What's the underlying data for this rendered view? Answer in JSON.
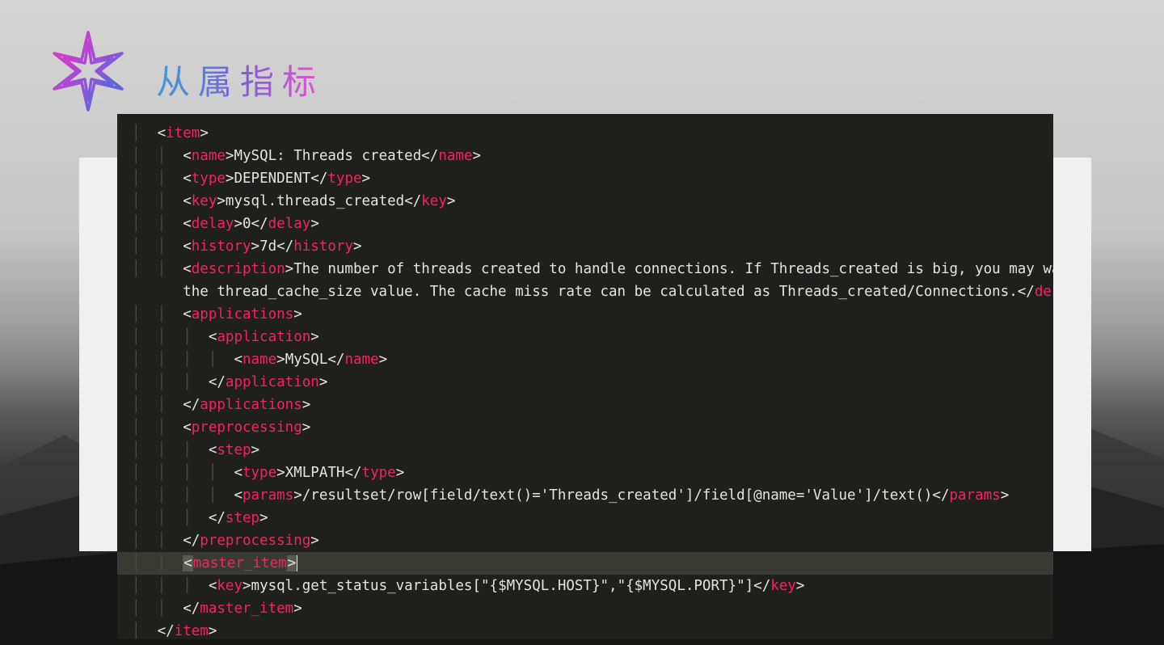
{
  "title": "从属指标",
  "code": {
    "lines": [
      {
        "indent": 1,
        "tokens": [
          {
            "t": "bracket",
            "v": "<"
          },
          {
            "t": "tag",
            "v": "item"
          },
          {
            "t": "bracket",
            "v": ">"
          }
        ]
      },
      {
        "indent": 2,
        "tokens": [
          {
            "t": "bracket",
            "v": "<"
          },
          {
            "t": "tag",
            "v": "name"
          },
          {
            "t": "bracket",
            "v": ">"
          },
          {
            "t": "text",
            "v": "MySQL: Threads created"
          },
          {
            "t": "bracket",
            "v": "</"
          },
          {
            "t": "tag",
            "v": "name"
          },
          {
            "t": "bracket",
            "v": ">"
          }
        ]
      },
      {
        "indent": 2,
        "tokens": [
          {
            "t": "bracket",
            "v": "<"
          },
          {
            "t": "tag",
            "v": "type"
          },
          {
            "t": "bracket",
            "v": ">"
          },
          {
            "t": "text",
            "v": "DEPENDENT"
          },
          {
            "t": "bracket",
            "v": "</"
          },
          {
            "t": "tag",
            "v": "type"
          },
          {
            "t": "bracket",
            "v": ">"
          }
        ]
      },
      {
        "indent": 2,
        "tokens": [
          {
            "t": "bracket",
            "v": "<"
          },
          {
            "t": "tag",
            "v": "key"
          },
          {
            "t": "bracket",
            "v": ">"
          },
          {
            "t": "text",
            "v": "mysql.threads_created"
          },
          {
            "t": "bracket",
            "v": "</"
          },
          {
            "t": "tag",
            "v": "key"
          },
          {
            "t": "bracket",
            "v": ">"
          }
        ]
      },
      {
        "indent": 2,
        "tokens": [
          {
            "t": "bracket",
            "v": "<"
          },
          {
            "t": "tag",
            "v": "delay"
          },
          {
            "t": "bracket",
            "v": ">"
          },
          {
            "t": "text",
            "v": "0"
          },
          {
            "t": "bracket",
            "v": "</"
          },
          {
            "t": "tag",
            "v": "delay"
          },
          {
            "t": "bracket",
            "v": ">"
          }
        ]
      },
      {
        "indent": 2,
        "tokens": [
          {
            "t": "bracket",
            "v": "<"
          },
          {
            "t": "tag",
            "v": "history"
          },
          {
            "t": "bracket",
            "v": ">"
          },
          {
            "t": "text",
            "v": "7d"
          },
          {
            "t": "bracket",
            "v": "</"
          },
          {
            "t": "tag",
            "v": "history"
          },
          {
            "t": "bracket",
            "v": ">"
          }
        ]
      },
      {
        "indent": 2,
        "tokens": [
          {
            "t": "bracket",
            "v": "<"
          },
          {
            "t": "tag",
            "v": "description"
          },
          {
            "t": "bracket",
            "v": ">"
          },
          {
            "t": "text",
            "v": "The number of threads created to handle connections. If Threads_created is big, you may want"
          }
        ]
      },
      {
        "indent": 2,
        "rawprefix": "",
        "tokens": [
          {
            "t": "text",
            "v": "the thread_cache_size value. The cache miss rate can be calculated as Threads_created/Connections."
          },
          {
            "t": "bracket",
            "v": "</"
          },
          {
            "t": "tag",
            "v": "descr"
          }
        ]
      },
      {
        "indent": 2,
        "tokens": [
          {
            "t": "bracket",
            "v": "<"
          },
          {
            "t": "tag",
            "v": "applications"
          },
          {
            "t": "bracket",
            "v": ">"
          }
        ]
      },
      {
        "indent": 3,
        "tokens": [
          {
            "t": "bracket",
            "v": "<"
          },
          {
            "t": "tag",
            "v": "application"
          },
          {
            "t": "bracket",
            "v": ">"
          }
        ]
      },
      {
        "indent": 4,
        "tokens": [
          {
            "t": "bracket",
            "v": "<"
          },
          {
            "t": "tag",
            "v": "name"
          },
          {
            "t": "bracket",
            "v": ">"
          },
          {
            "t": "text",
            "v": "MySQL"
          },
          {
            "t": "bracket",
            "v": "</"
          },
          {
            "t": "tag",
            "v": "name"
          },
          {
            "t": "bracket",
            "v": ">"
          }
        ]
      },
      {
        "indent": 3,
        "tokens": [
          {
            "t": "bracket",
            "v": "</"
          },
          {
            "t": "tag",
            "v": "application"
          },
          {
            "t": "bracket",
            "v": ">"
          }
        ]
      },
      {
        "indent": 2,
        "tokens": [
          {
            "t": "bracket",
            "v": "</"
          },
          {
            "t": "tag",
            "v": "applications"
          },
          {
            "t": "bracket",
            "v": ">"
          }
        ]
      },
      {
        "indent": 2,
        "tokens": [
          {
            "t": "bracket",
            "v": "<"
          },
          {
            "t": "tag",
            "v": "preprocessing"
          },
          {
            "t": "bracket",
            "v": ">"
          }
        ]
      },
      {
        "indent": 3,
        "tokens": [
          {
            "t": "bracket",
            "v": "<"
          },
          {
            "t": "tag",
            "v": "step"
          },
          {
            "t": "bracket",
            "v": ">"
          }
        ]
      },
      {
        "indent": 4,
        "tokens": [
          {
            "t": "bracket",
            "v": "<"
          },
          {
            "t": "tag",
            "v": "type"
          },
          {
            "t": "bracket",
            "v": ">"
          },
          {
            "t": "text",
            "v": "XMLPATH"
          },
          {
            "t": "bracket",
            "v": "</"
          },
          {
            "t": "tag",
            "v": "type"
          },
          {
            "t": "bracket",
            "v": ">"
          }
        ]
      },
      {
        "indent": 4,
        "tokens": [
          {
            "t": "bracket",
            "v": "<"
          },
          {
            "t": "tag",
            "v": "params"
          },
          {
            "t": "bracket",
            "v": ">"
          },
          {
            "t": "text",
            "v": "/resultset/row[field/text()='Threads_created']/field[@name='Value']/text()"
          },
          {
            "t": "bracket",
            "v": "</"
          },
          {
            "t": "tag",
            "v": "params"
          },
          {
            "t": "bracket",
            "v": ">"
          }
        ]
      },
      {
        "indent": 3,
        "tokens": [
          {
            "t": "bracket",
            "v": "</"
          },
          {
            "t": "tag",
            "v": "step"
          },
          {
            "t": "bracket",
            "v": ">"
          }
        ]
      },
      {
        "indent": 2,
        "tokens": [
          {
            "t": "bracket",
            "v": "</"
          },
          {
            "t": "tag",
            "v": "preprocessing"
          },
          {
            "t": "bracket",
            "v": ">"
          }
        ]
      },
      {
        "indent": 2,
        "highlighted": true,
        "matchbrackets": true,
        "tokens": [
          {
            "t": "hl-bracket",
            "v": "<"
          },
          {
            "t": "tag",
            "v": "master_item"
          },
          {
            "t": "hl-bracket",
            "v": ">"
          }
        ],
        "cursor": true
      },
      {
        "indent": 3,
        "tokens": [
          {
            "t": "bracket",
            "v": "<"
          },
          {
            "t": "tag",
            "v": "key"
          },
          {
            "t": "bracket",
            "v": ">"
          },
          {
            "t": "text",
            "v": "mysql.get_status_variables[\"{$MYSQL.HOST}\",\"{$MYSQL.PORT}\"]"
          },
          {
            "t": "bracket",
            "v": "</"
          },
          {
            "t": "tag",
            "v": "key"
          },
          {
            "t": "bracket",
            "v": ">"
          }
        ]
      },
      {
        "indent": 2,
        "tokens": [
          {
            "t": "bracket",
            "v": "</"
          },
          {
            "t": "tag",
            "v": "master_item"
          },
          {
            "t": "bracket",
            "v": ">"
          }
        ]
      },
      {
        "indent": 1,
        "tokens": [
          {
            "t": "bracket",
            "v": "</"
          },
          {
            "t": "tag",
            "v": "item"
          },
          {
            "t": "bracket",
            "v": ">"
          }
        ]
      }
    ]
  },
  "colors": {
    "tag": "#f4245e",
    "text": "#e4e4e4",
    "background": "#1f1f1d"
  }
}
